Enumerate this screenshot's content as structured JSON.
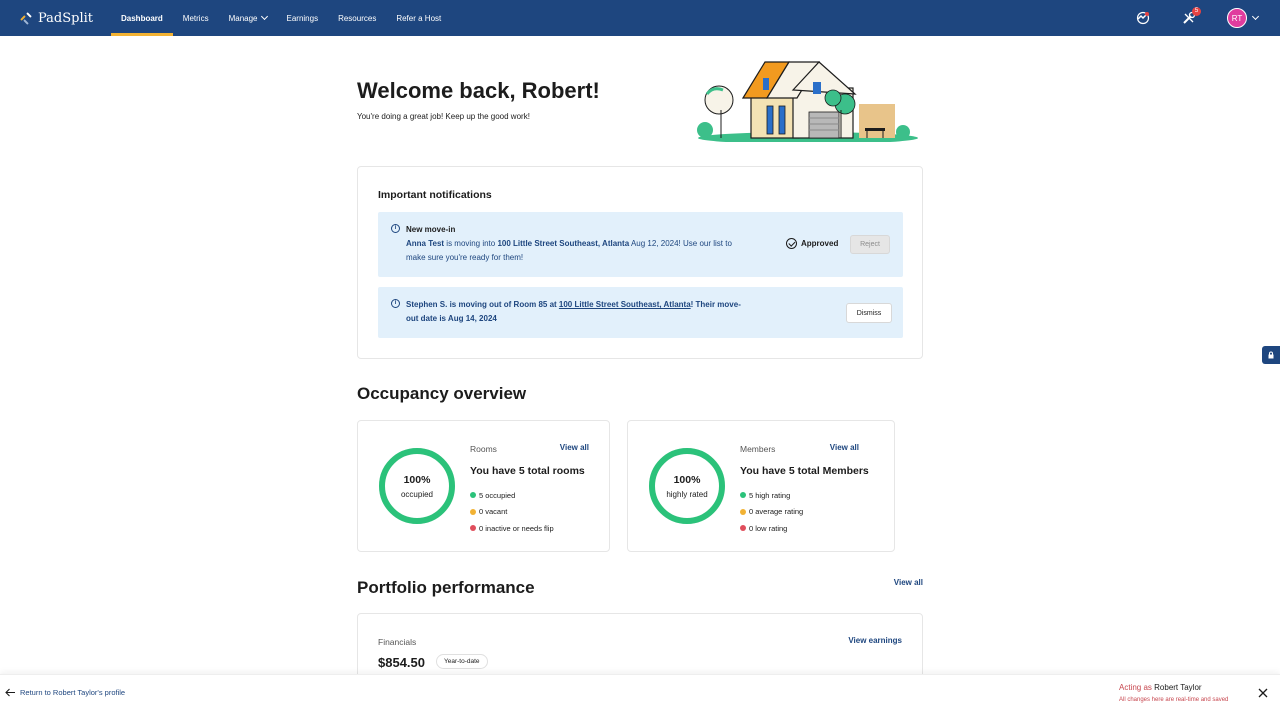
{
  "brand": {
    "name": "PadSplit"
  },
  "nav": {
    "items": [
      {
        "label": "Dashboard",
        "active": true
      },
      {
        "label": "Metrics"
      },
      {
        "label": "Manage",
        "dropdown": true
      },
      {
        "label": "Earnings"
      },
      {
        "label": "Resources"
      },
      {
        "label": "Refer a Host"
      }
    ],
    "notification_count": "5",
    "avatar_initials": "RT"
  },
  "welcome": {
    "title": "Welcome back, Robert!",
    "subtitle": "You're doing a great job! Keep up the good work!"
  },
  "notifications": {
    "title": "Important notifications",
    "movein": {
      "title": "New move-in",
      "member": "Anna Test",
      "text_1": " is moving into ",
      "address": "100 Little Street Southeast, Atlanta",
      "text_2": " Aug 12, 2024! Use our list to",
      "text_3": "make sure you're ready for them!",
      "status": "Approved",
      "reject_label": "Reject"
    },
    "moveout": {
      "text_1": "Stephen S. is moving out of Room 85 at ",
      "address": "100 Little Street Southeast, Atlanta",
      "text_2": "! Their move-",
      "text_3": "out date is Aug 14, 2024",
      "dismiss_label": "Dismiss"
    }
  },
  "occupancy": {
    "title": "Occupancy overview",
    "rooms": {
      "label": "Rooms",
      "view_all": "View all",
      "headline": "You have 5 total rooms",
      "percent": "100%",
      "percent_label": "occupied",
      "fill_fraction": 1.0,
      "legend": [
        {
          "text": "5 occupied",
          "color": "#2bc27a"
        },
        {
          "text": "0 vacant",
          "color": "#f2b233"
        },
        {
          "text": "0 inactive or needs flip",
          "color": "#e04e5c"
        }
      ]
    },
    "members": {
      "label": "Members",
      "view_all": "View all",
      "headline": "You have 5 total Members",
      "percent": "100%",
      "percent_label": "highly rated",
      "fill_fraction": 1.0,
      "legend": [
        {
          "text": "5 high rating",
          "color": "#2bc27a"
        },
        {
          "text": "0 average rating",
          "color": "#f2b233"
        },
        {
          "text": "0 low rating",
          "color": "#e04e5c"
        }
      ]
    }
  },
  "portfolio": {
    "title": "Portfolio performance",
    "view_all": "View all",
    "financials": {
      "label": "Financials",
      "view_earnings": "View earnings",
      "amount": "$854.50",
      "period": "Year-to-date"
    }
  },
  "impersonation": {
    "return_label": "Return to Robert Taylor's profile",
    "acting_label": "Acting as",
    "acting_name": "Robert Taylor",
    "notice": "All changes here are real-time and saved"
  },
  "colors": {
    "nav_bg": "#1e467f",
    "accent": "#f2b233",
    "success": "#2bc27a",
    "notice_bg": "#e2f0fb",
    "alert": "#c7474f"
  }
}
